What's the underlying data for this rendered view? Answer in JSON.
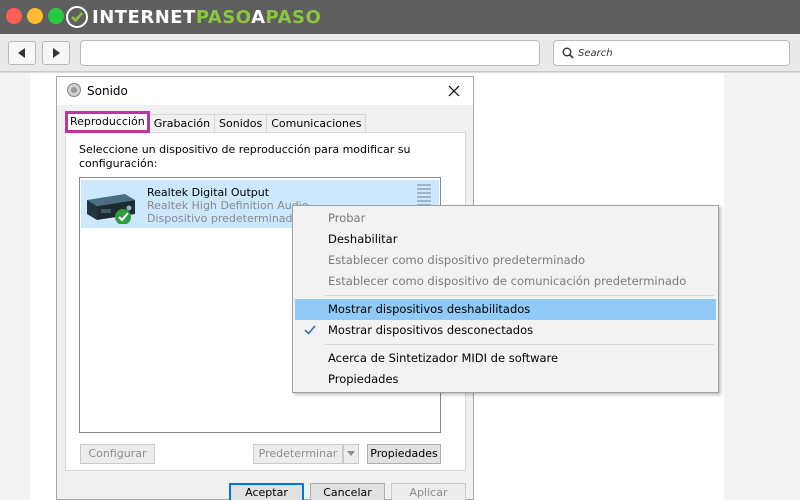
{
  "browser": {
    "logo_text_a": "INTERNET",
    "logo_text_b": "PASO",
    "logo_text_c": "A",
    "logo_text_d": "PASO",
    "search_placeholder": "Search",
    "colors": {
      "close": "#ff5f57",
      "minimize": "#febc2e",
      "maximize": "#28c840",
      "accent": "#8cc63f"
    }
  },
  "dialog": {
    "title": "Sonido",
    "tabs": [
      "Reproducción",
      "Grabación",
      "Sonidos",
      "Comunicaciones"
    ],
    "active_tab": "Reproducción",
    "instructions": "Seleccione un dispositivo de reproducción para modificar su configuración:",
    "device": {
      "name": "Realtek Digital Output",
      "driver": "Realtek High Definition Audio",
      "status": "Dispositivo predeterminado"
    },
    "buttons": {
      "configure": "Configurar",
      "set_default": "Predeterminar",
      "properties": "Propiedades",
      "ok": "Aceptar",
      "cancel": "Cancelar",
      "apply": "Aplicar"
    }
  },
  "context_menu": {
    "items": [
      {
        "label": "Probar",
        "disabled": true
      },
      {
        "label": "Deshabilitar",
        "disabled": false
      },
      {
        "label": "Establecer como dispositivo predeterminado",
        "disabled": true
      },
      {
        "label": "Establecer como dispositivo de comunicación predeterminado",
        "disabled": true
      },
      {
        "label": "Mostrar dispositivos deshabilitados",
        "highlighted": true
      },
      {
        "label": "Mostrar dispositivos desconectados",
        "checked": true
      },
      {
        "label": "Acerca de Sintetizador MIDI de software"
      },
      {
        "label": "Propiedades"
      }
    ]
  }
}
